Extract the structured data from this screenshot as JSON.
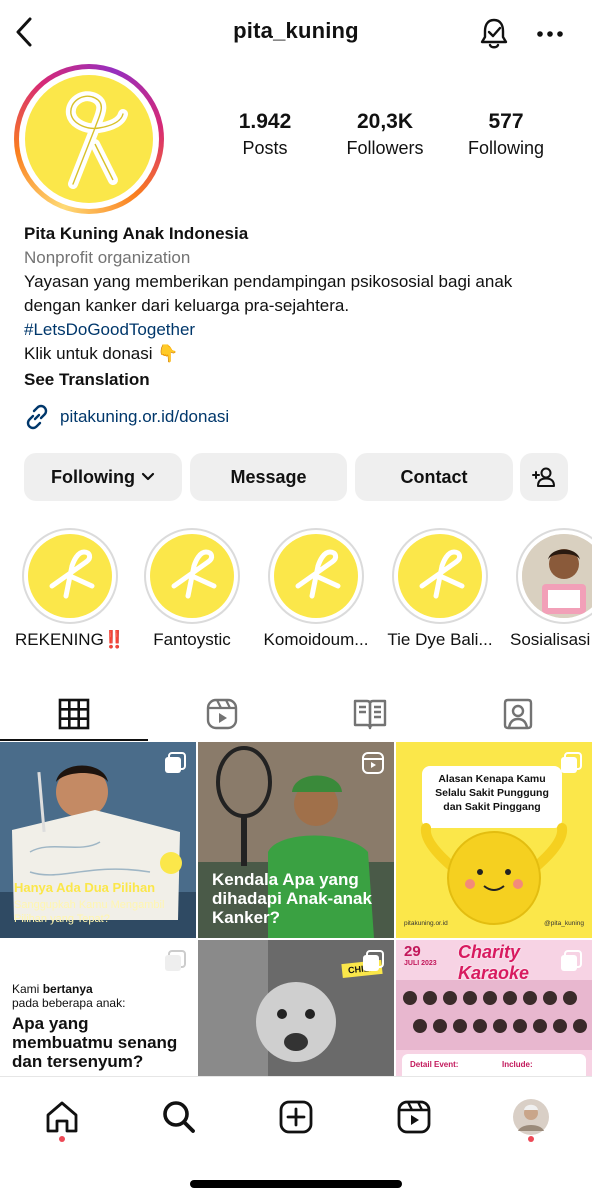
{
  "header": {
    "username": "pita_kuning"
  },
  "profile": {
    "stats": [
      {
        "value": "1.942",
        "label": "Posts"
      },
      {
        "value": "20,3K",
        "label": "Followers"
      },
      {
        "value": "577",
        "label": "Following"
      }
    ],
    "name": "Pita Kuning Anak Indonesia",
    "category": "Nonprofit organization",
    "bio_line1": "Yayasan yang memberikan pendampingan psikososial bagi anak",
    "bio_line2": "dengan kanker dari keluarga pra-sejahtera.",
    "hashtag": "#LetsDoGoodTogether",
    "cta": "Klik untuk donasi 👇",
    "see_translation": "See Translation",
    "link": "pitakuning.or.id/donasi"
  },
  "actions": {
    "following": "Following",
    "message": "Message",
    "contact": "Contact"
  },
  "highlights": [
    {
      "label": "REKENING‼️"
    },
    {
      "label": "Fantoystic"
    },
    {
      "label": "Komoidoum..."
    },
    {
      "label": "Tie Dye Bali..."
    },
    {
      "label": "Sosialisasi"
    }
  ],
  "posts": [
    {
      "title": "Hanya Ada Dua Pilihan",
      "subtitle": "Sanggupkah Kamu Mengambil Pilihan yang Tepat?"
    },
    {
      "title": "Kendala Apa yang dihadapi Anak-anak Kanker?"
    },
    {
      "title": "Alasan Kenapa Kamu Selalu Sakit Punggung dan Sakit Pinggang",
      "footer_left": "pitakuning.or.id",
      "footer_right": "@pita_kuning"
    },
    {
      "intro_prefix": "Kami ",
      "intro_bold": "bertanya",
      "intro_rest": "pada beberapa anak:",
      "title": "Apa yang membuatmu senang dan tersenyum?"
    },
    {
      "badge": "CHILD"
    },
    {
      "date_day": "29",
      "date_rest": "JULI 2023",
      "title": "Charity Karaoke",
      "detail_heading": "Detail Event:",
      "include_heading": "Include:"
    }
  ],
  "colors": {
    "brand_yellow": "#fbe74a",
    "link_blue": "#00376b",
    "notification_red": "#ed4956"
  }
}
